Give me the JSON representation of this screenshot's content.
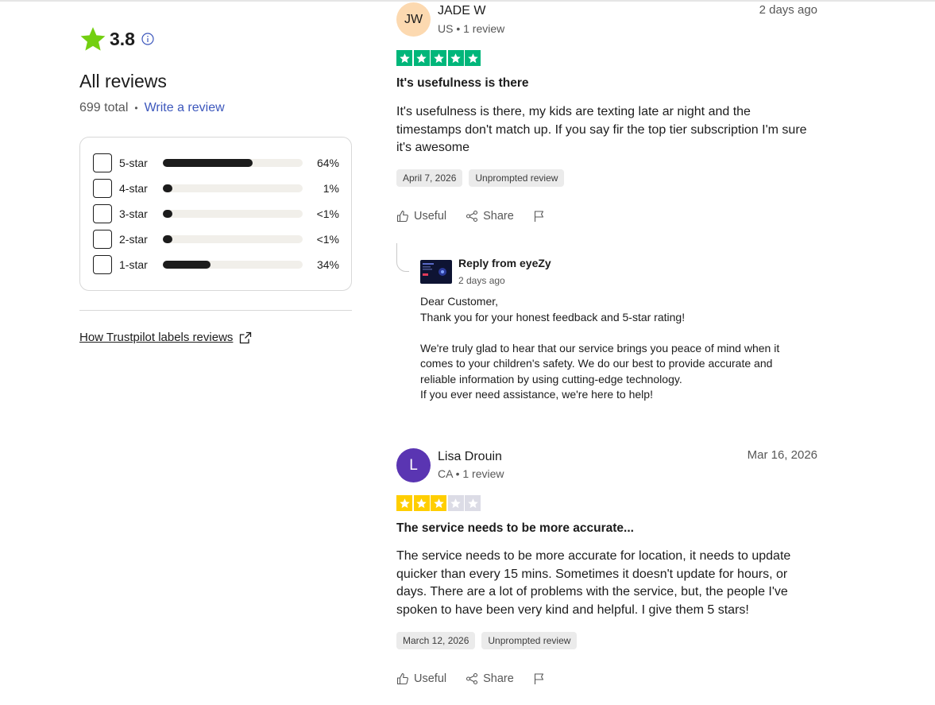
{
  "summary": {
    "rating": "3.8",
    "heading": "All reviews",
    "total": "699 total",
    "separator": "•",
    "write_review": "Write a review",
    "distribution": [
      {
        "label": "5-star",
        "percent_text": "64%",
        "fill": 0.64
      },
      {
        "label": "4-star",
        "percent_text": "1%",
        "fill": 0.01
      },
      {
        "label": "3-star",
        "percent_text": "<1%",
        "fill": 0.005
      },
      {
        "label": "2-star",
        "percent_text": "<1%",
        "fill": 0.005
      },
      {
        "label": "1-star",
        "percent_text": "34%",
        "fill": 0.34
      }
    ],
    "labels_link": "How Trustpilot labels reviews"
  },
  "colors": {
    "five_star_green": "#00b67a",
    "three_star_yellow": "#ffce00",
    "empty_star": "#dcdce6",
    "link_blue": "#3c57bc",
    "big_star": "#73cf11"
  },
  "reviews": [
    {
      "initials": "JW",
      "name": "JADE W",
      "meta": "US • 1 review",
      "date": "2 days ago",
      "stars": 5,
      "title": "It's usefulness is there",
      "body": "It's usefulness is there, my kids are texting late ar night and the timestamps don't match up. If you say fir the top tier subscription I'm sure it's awesome",
      "tags": [
        "April 7, 2026",
        "Unprompted review"
      ],
      "actions": {
        "useful": "Useful",
        "share": "Share"
      },
      "reply": {
        "from": "Reply from eyeZy",
        "time": "2 days ago",
        "line1": "Dear Customer,",
        "line2": "Thank you for your honest feedback and 5-star rating!",
        "line3": "We're truly glad to hear that our service brings you peace of mind when it comes to your children's safety. We do our best to provide accurate and reliable information by using cutting-edge technology.",
        "line4": "If you ever need assistance, we're here to help!"
      }
    },
    {
      "initials": "L",
      "name": "Lisa Drouin",
      "meta": "CA • 1 review",
      "date": "Mar 16, 2026",
      "stars": 3,
      "title": "The service needs to be more accurate...",
      "body": "The service needs to be more accurate for location, it needs to update quicker than every 15 mins. Sometimes it doesn't update for hours, or days. There are a lot of problems with the service, but, the people I've spoken to have been very kind and helpful. I give them 5 stars!",
      "tags": [
        "March 12, 2026",
        "Unprompted review"
      ],
      "actions": {
        "useful": "Useful",
        "share": "Share"
      }
    }
  ]
}
